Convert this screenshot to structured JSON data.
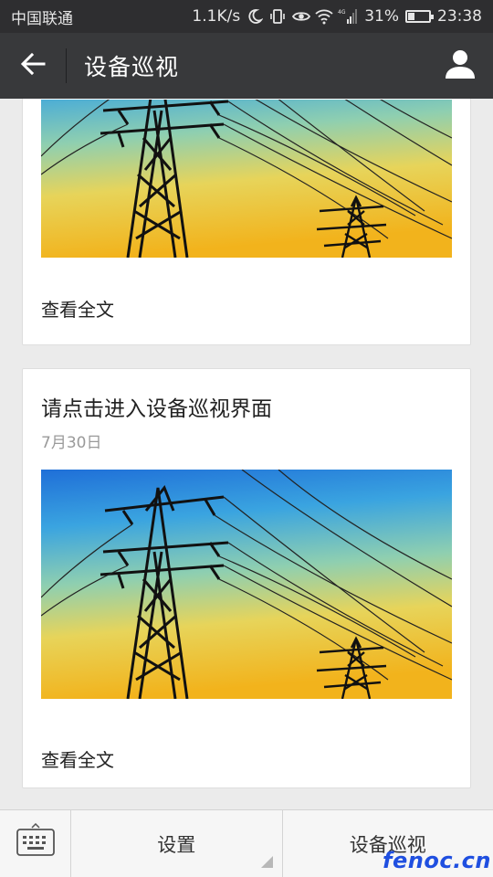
{
  "status_bar": {
    "carrier": "中国联通",
    "net_speed": "1.1K/s",
    "network_type": "4G",
    "battery_percent": "31%",
    "battery_level": 0.31,
    "time": "23:38"
  },
  "header": {
    "title": "设备巡视",
    "back_icon": "arrow-left-icon",
    "user_icon": "person-icon"
  },
  "articles": [
    {
      "title": "",
      "date": "",
      "image": "power-tower-sunset",
      "read_more": "查看全文"
    },
    {
      "title": "请点击进入设备巡视界面",
      "date": "7月30日",
      "image": "power-tower-sunset",
      "read_more": "查看全文"
    }
  ],
  "bottom_menu": {
    "keyboard_icon": "keyboard-icon",
    "items": [
      {
        "label": "设置",
        "has_submenu": true
      },
      {
        "label": "设备巡视",
        "has_submenu": false
      }
    ]
  },
  "watermark": "fenoc.cn",
  "colors": {
    "title_bar": "#38393b",
    "status_bar": "#2e2e30",
    "background": "#ebebeb",
    "watermark": "#1f4fe0"
  }
}
